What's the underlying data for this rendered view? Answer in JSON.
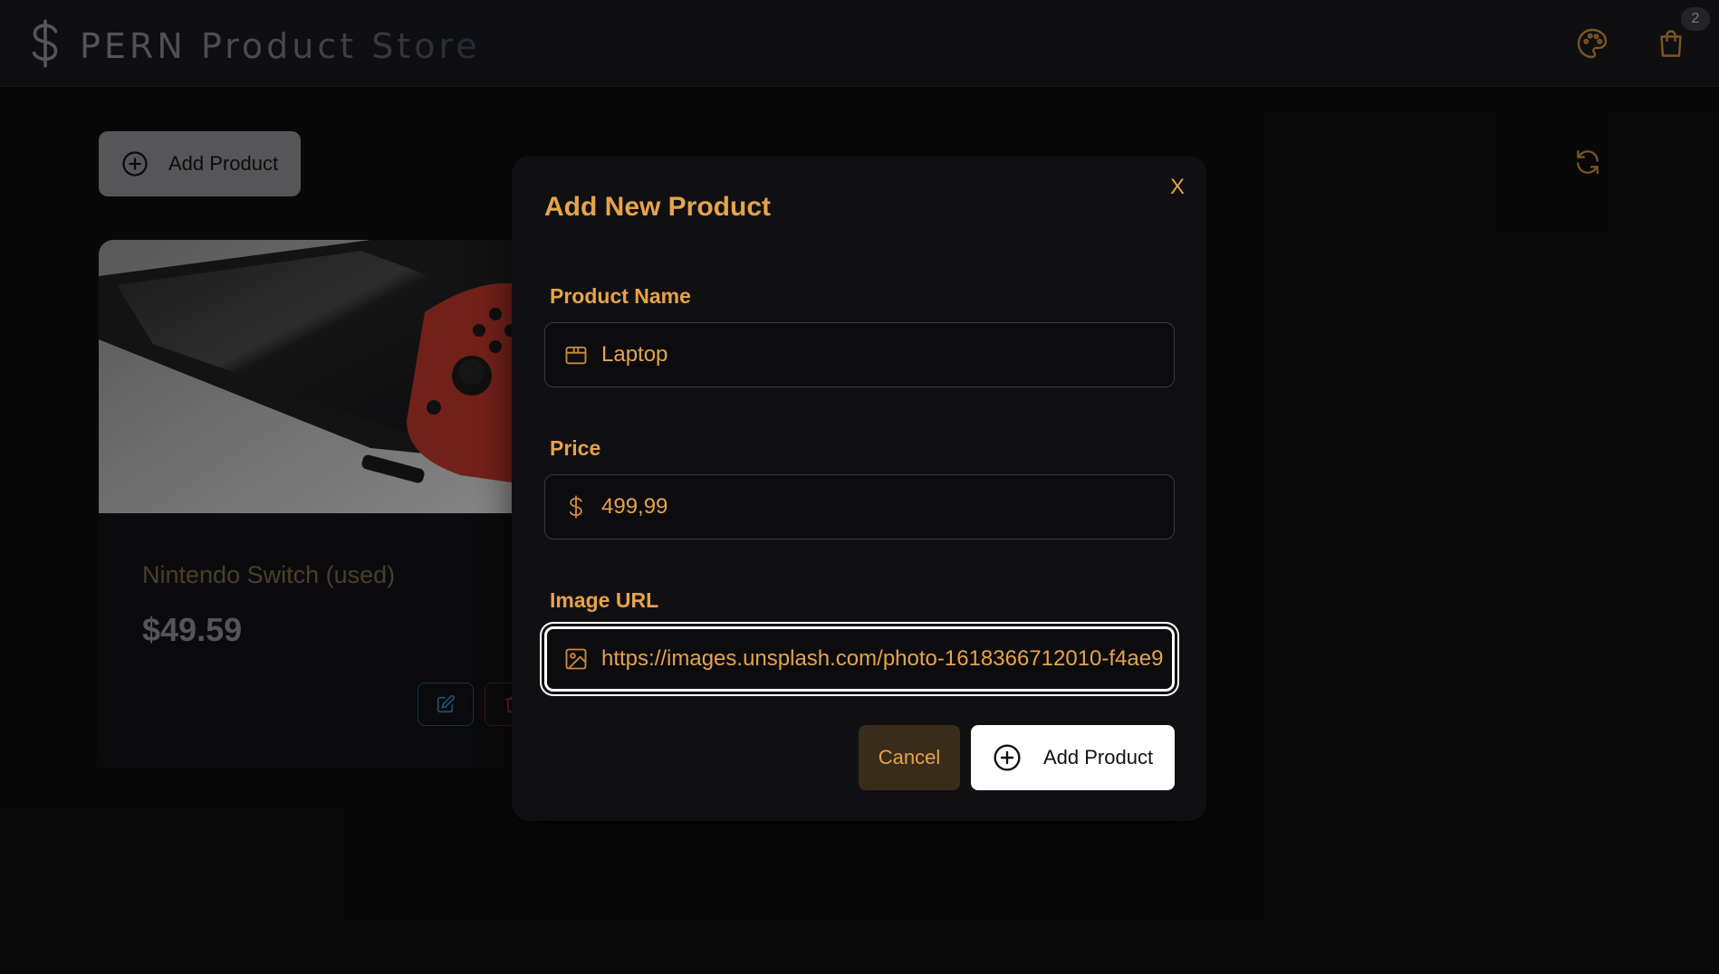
{
  "header": {
    "title": "PERN Product Store",
    "cart_count": "2"
  },
  "main": {
    "add_button_label": "Add Product"
  },
  "product_card": {
    "name": "Nintendo Switch (used)",
    "price": "$49.59"
  },
  "modal": {
    "title": "Add New Product",
    "close_label": "X",
    "fields": {
      "name": {
        "label": "Product Name",
        "value": "Laptop",
        "icon": "package-icon"
      },
      "price": {
        "label": "Price",
        "value": "499,99",
        "icon": "dollar-icon"
      },
      "image": {
        "label": "Image URL",
        "value": "https://images.unsplash.com/photo-1618366712010-f4ae9",
        "icon": "image-icon"
      }
    },
    "cancel_label": "Cancel",
    "submit_label": "Add Product"
  },
  "colors": {
    "accent": "#e6a34b",
    "background": "#0e0e10",
    "modal_bg": "#101013"
  }
}
